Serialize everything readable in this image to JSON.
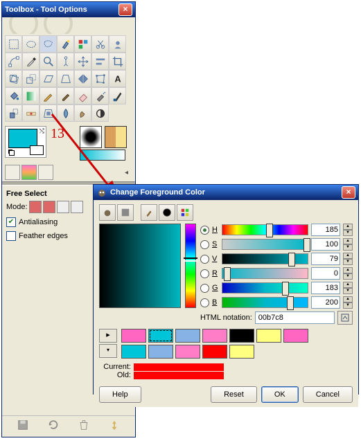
{
  "toolbox": {
    "title": "Toolbox - Tool Options",
    "callout": "13",
    "fg_color": "#00c0d6",
    "bg_color": "#ffffff",
    "options_title": "Free Select",
    "mode_label": "Mode:",
    "antialias_label": "Antialiasing",
    "antialias_checked": true,
    "feather_label": "Feather edges",
    "feather_checked": false
  },
  "dialog": {
    "title": "Change Foreground Color",
    "channels": [
      {
        "key": "H",
        "value": "185",
        "selected": true,
        "grad": "linear-gradient(to right,#f00,#ff0,#0f0,#0ff,#00f,#f0f,#f00)",
        "thumb_pct": 51
      },
      {
        "key": "S",
        "value": "100",
        "selected": false,
        "grad": "linear-gradient(to right,#ccc,#00b7c8)",
        "thumb_pct": 95
      },
      {
        "key": "V",
        "value": "79",
        "selected": false,
        "grad": "linear-gradient(to right,#000,#00b7c8)",
        "thumb_pct": 77
      },
      {
        "key": "R",
        "value": "0",
        "selected": false,
        "grad": "linear-gradient(to right,#00b7c8,#ffb7c8)",
        "thumb_pct": 2
      },
      {
        "key": "G",
        "value": "183",
        "selected": false,
        "grad": "linear-gradient(to right,#0000c8,#00b7c8,#00ffc8)",
        "thumb_pct": 70
      },
      {
        "key": "B",
        "value": "200",
        "selected": false,
        "grad": "linear-gradient(to right,#00b700,#00b7c8,#00b7ff)",
        "thumb_pct": 76
      }
    ],
    "html_label": "HTML notation:",
    "html_value": "00b7c8",
    "swatches": [
      "#ff66c2",
      "#00c4d8",
      "#87b2e6",
      "#ff7dc7",
      "#000000",
      "#ffff80",
      "#ff66c2",
      "#00c4d8",
      "#87b2e6",
      "#ff7dc7",
      "#ff0000",
      "#ffff80"
    ],
    "selected_swatch_index": 1,
    "current_label": "Current:",
    "old_label": "Old:",
    "current_color": "#ff0000",
    "old_color": "#ff0000",
    "buttons": {
      "help": "Help",
      "reset": "Reset",
      "ok": "OK",
      "cancel": "Cancel"
    }
  }
}
